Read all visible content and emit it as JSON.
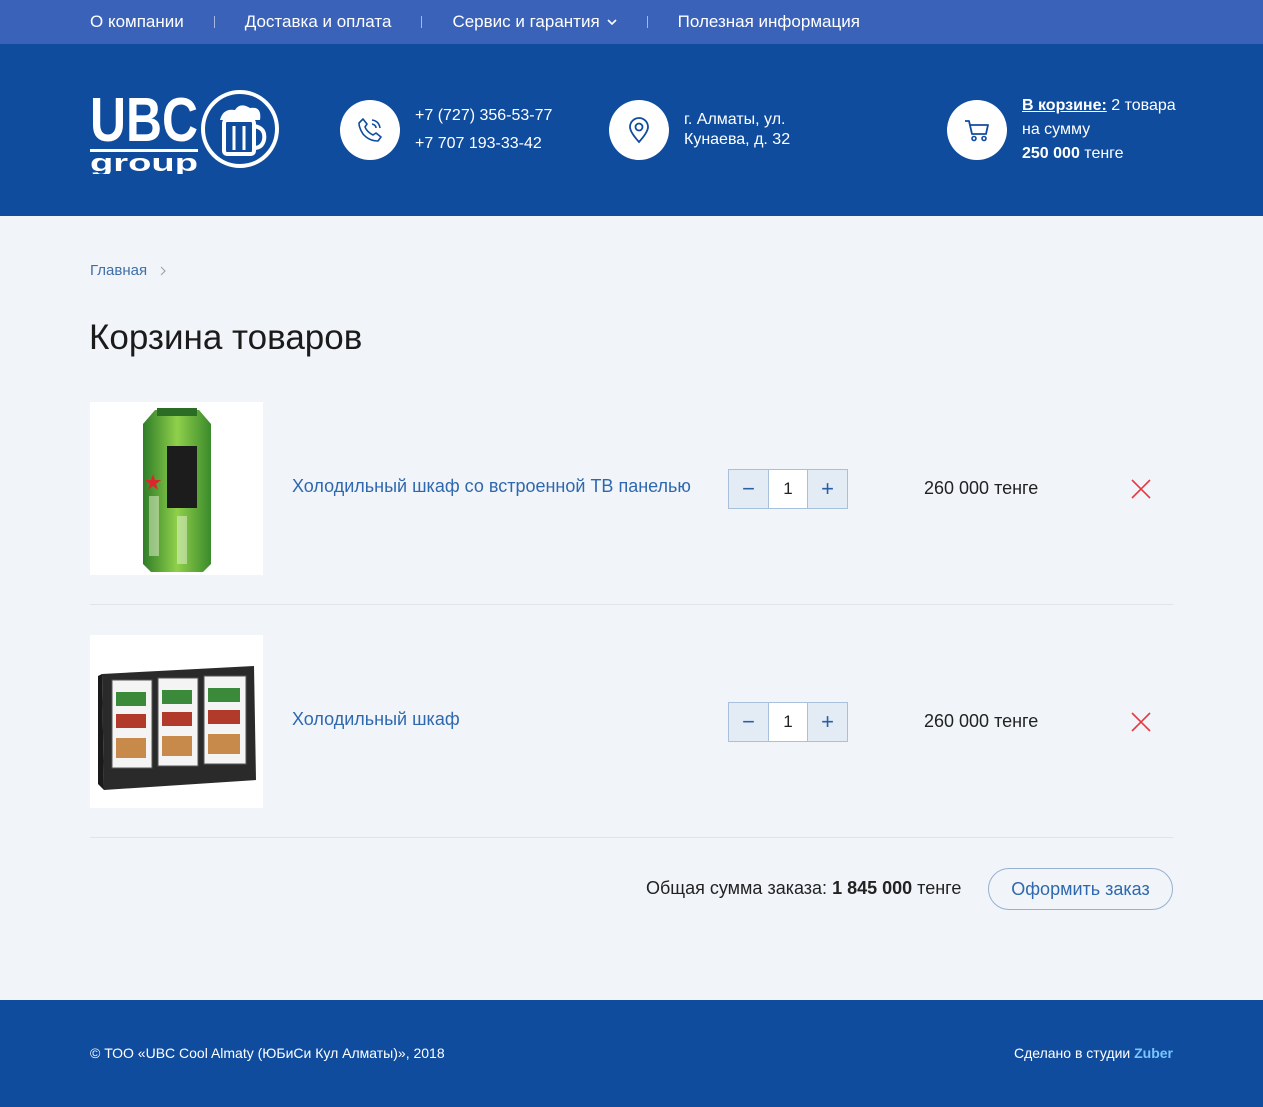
{
  "topnav": {
    "items": [
      {
        "label": "О компании"
      },
      {
        "label": "Доставка и оплата"
      },
      {
        "label": "Сервис и гарантия"
      },
      {
        "label": "Полезная информация"
      }
    ]
  },
  "header": {
    "logo_text": "UBC group",
    "phones": [
      "+7 (727) 356-53-77",
      "+7 707 193-33-42"
    ],
    "address": [
      "г. Алматы, ул.",
      "Кунаева, д. 32"
    ],
    "cart": {
      "link_label": "В корзине:",
      "count_text": "2 товара",
      "sum_label": "на сумму",
      "sum_value": "250 000",
      "currency": "тенге"
    }
  },
  "breadcrumb": {
    "home": "Главная"
  },
  "page_title": "Корзина товаров",
  "cart_items": [
    {
      "name": "Холодильный шкаф со встроенной ТВ панелью",
      "qty": "1",
      "price": "260 000 тенге",
      "minus": "−",
      "plus": "+"
    },
    {
      "name": "Холодильный шкаф",
      "qty": "1",
      "price": "260 000 тенге",
      "minus": "−",
      "plus": "+"
    }
  ],
  "summary": {
    "label": "Общая сумма заказа:",
    "value": "1 845 000",
    "currency": "тенге",
    "checkout_label": "Оформить заказ"
  },
  "footer": {
    "copyright": "© ТОО «UBC Cool Almaty (ЮБиСи Кул Алматы)», 2018",
    "credit_prefix": "Сделано в студии",
    "credit_studio": "Zuber"
  },
  "colors": {
    "topnav_bg": "#3a62b8",
    "header_bg": "#104c9e",
    "page_bg": "#f1f5fa",
    "link": "#2f68ae",
    "remove": "#e5393f",
    "studio_link": "#78c6ff"
  }
}
